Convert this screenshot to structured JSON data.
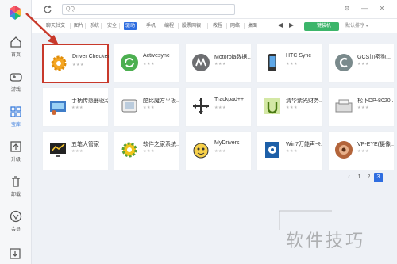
{
  "search": {
    "value": "QQ"
  },
  "sidebar": {
    "items": [
      {
        "label": "首页",
        "icon": "home-icon"
      },
      {
        "label": "游戏",
        "icon": "gamepad-icon"
      },
      {
        "label": "宝库",
        "icon": "grid-icon"
      },
      {
        "label": "升级",
        "icon": "upgrade-icon"
      },
      {
        "label": "卸载",
        "icon": "trash-icon"
      },
      {
        "label": "会员",
        "icon": "vip-icon"
      }
    ]
  },
  "categories": [
    "聊天社交",
    "图片",
    "系统",
    "安全",
    "驱动",
    "手机",
    "编程",
    "股票网银",
    "教程",
    "网络",
    "桌面"
  ],
  "active_category": "驱动",
  "toolbar": {
    "install_label": "一键装机",
    "sort_label": "默认排序 ▾"
  },
  "apps": [
    {
      "name": "Driver Checker",
      "stars": "★★★"
    },
    {
      "name": "Activesync",
      "stars": "★★★"
    },
    {
      "name": "Motorola数据...",
      "stars": "★★★"
    },
    {
      "name": "HTC Sync",
      "stars": "★★★"
    },
    {
      "name": "GCS加密狗...",
      "stars": "★★★"
    },
    {
      "name": "手柄传感器驱动",
      "stars": "★★★"
    },
    {
      "name": "酷比魔方平板...",
      "stars": "★★★"
    },
    {
      "name": "Trackpad++",
      "stars": "★★★"
    },
    {
      "name": "清华紫光财务...",
      "stars": "★★★"
    },
    {
      "name": "松下DP-8020...",
      "stars": "★★★"
    },
    {
      "name": "五笔大管家",
      "stars": "★★★"
    },
    {
      "name": "软件之家系统...",
      "stars": "★★★"
    },
    {
      "name": "MyDrivers",
      "stars": "★★★"
    },
    {
      "name": "Win7万能声卡...",
      "stars": "★★★"
    },
    {
      "name": "VP-EYE(摄像...",
      "stars": "★★★"
    }
  ],
  "pagination": {
    "pages": [
      "1",
      "2",
      "3"
    ],
    "current": "3"
  },
  "watermark": {
    "text": "软件技巧"
  },
  "colors": {
    "accent": "#2e6de0",
    "install": "#3cb56a",
    "highlight": "#c8392b"
  }
}
